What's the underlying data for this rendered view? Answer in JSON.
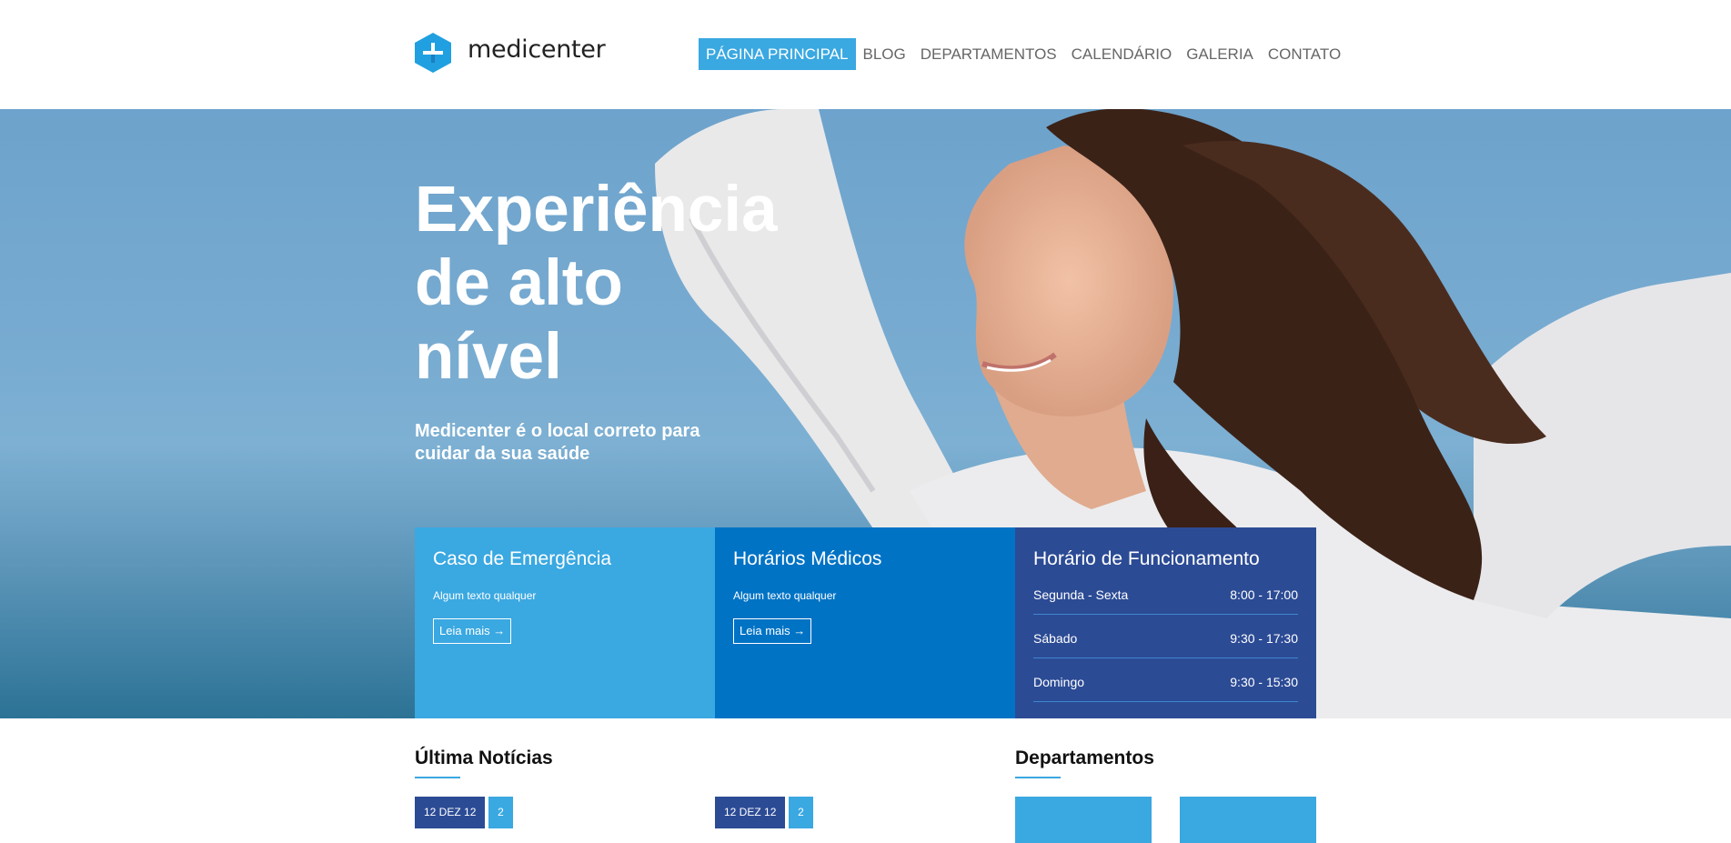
{
  "brand": {
    "name": "medicenter",
    "logo_icon": "plus-hexagon-icon",
    "accent": "#3aa8e1"
  },
  "nav": {
    "items": [
      {
        "label": "PÁGINA PRINCIPAL",
        "active": true
      },
      {
        "label": "BLOG"
      },
      {
        "label": "DEPARTAMENTOS"
      },
      {
        "label": "CALENDÁRIO"
      },
      {
        "label": "GALERIA"
      },
      {
        "label": "CONTATO"
      }
    ]
  },
  "hero": {
    "title_lines": [
      "Experiência",
      "de alto",
      "nível"
    ],
    "subtitle_lines": [
      "Medicenter é o local correto para",
      "cuidar da sua saúde"
    ]
  },
  "boxes": {
    "emergency": {
      "title": "Caso de Emergência",
      "text": "Algum texto qualquer",
      "button": "Leia mais →",
      "color": "#3aa8e1"
    },
    "doctors": {
      "title": "Horários Médicos",
      "text": "Algum texto qualquer",
      "button": "Leia mais →",
      "color": "#0073c5"
    },
    "hours": {
      "title": "Horário de Funcionamento",
      "color": "#2c4b95",
      "rows": [
        {
          "day": "Segunda - Sexta",
          "time": "8:00 - 17:00"
        },
        {
          "day": "Sábado",
          "time": "9:30 - 17:30"
        },
        {
          "day": "Domingo",
          "time": "9:30 - 15:30"
        }
      ]
    }
  },
  "news": {
    "title": "Última Notícias",
    "items": [
      {
        "date": "12 DEZ 12",
        "count": "2"
      },
      {
        "date": "12 DEZ 12",
        "count": "2"
      }
    ]
  },
  "departments": {
    "title": "Departamentos"
  }
}
